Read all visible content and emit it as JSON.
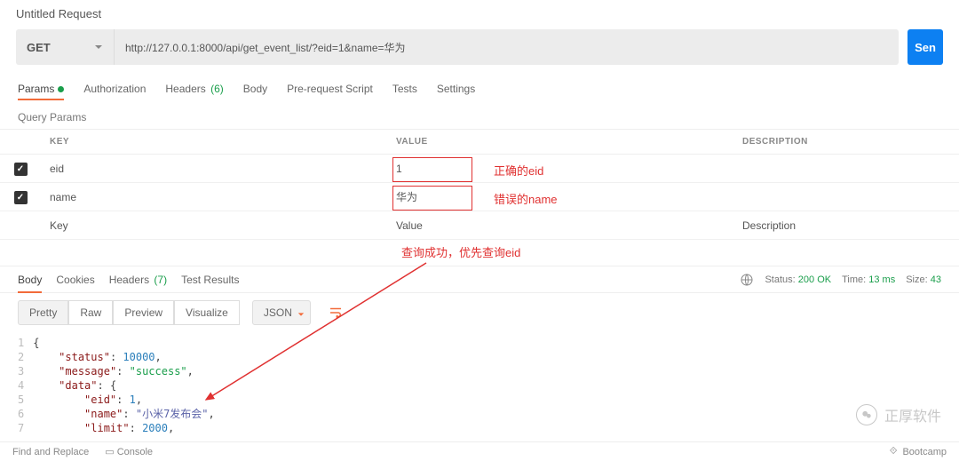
{
  "title": "Untitled Request",
  "method": "GET",
  "url": "http://127.0.0.1:8000/api/get_event_list/?eid=1&name=华为",
  "send_label": "Sen",
  "req_tabs": {
    "params": "Params",
    "auth": "Authorization",
    "headers": "Headers",
    "headers_count": "(6)",
    "body": "Body",
    "prereq": "Pre-request Script",
    "tests": "Tests",
    "settings": "Settings"
  },
  "query_label": "Query Params",
  "columns": {
    "key": "KEY",
    "value": "VALUE",
    "desc": "DESCRIPTION"
  },
  "rows": [
    {
      "key": "eid",
      "value": "1",
      "annot": "正确的eid"
    },
    {
      "key": "name",
      "value": "华为",
      "annot": "错误的name"
    }
  ],
  "placeholders": {
    "key": "Key",
    "value": "Value",
    "desc": "Description"
  },
  "center_annot": "查询成功，优先查询eid",
  "resp_tabs": {
    "body": "Body",
    "cookies": "Cookies",
    "headers": "Headers",
    "headers_count": "(7)",
    "tests": "Test Results"
  },
  "status": {
    "label": "Status:",
    "code": "200 OK",
    "time_label": "Time:",
    "time": "13 ms",
    "size_label": "Size:",
    "size": "43"
  },
  "view_btns": {
    "pretty": "Pretty",
    "raw": "Raw",
    "preview": "Preview",
    "visualize": "Visualize",
    "format": "JSON"
  },
  "json_body": {
    "status": 10000,
    "message": "success",
    "data": {
      "eid": 1,
      "name": "小米7发布会",
      "limit": 2000
    }
  },
  "chart_data": {
    "type": "table",
    "title": "Response JSON",
    "rows": [
      [
        "status",
        10000
      ],
      [
        "message",
        "success"
      ],
      [
        "data.eid",
        1
      ],
      [
        "data.name",
        "小米7发布会"
      ],
      [
        "data.limit",
        2000
      ]
    ]
  },
  "footer": {
    "find": "Find and Replace",
    "console": "Console",
    "boot": "Bootcamp"
  },
  "watermark": "正厚软件"
}
